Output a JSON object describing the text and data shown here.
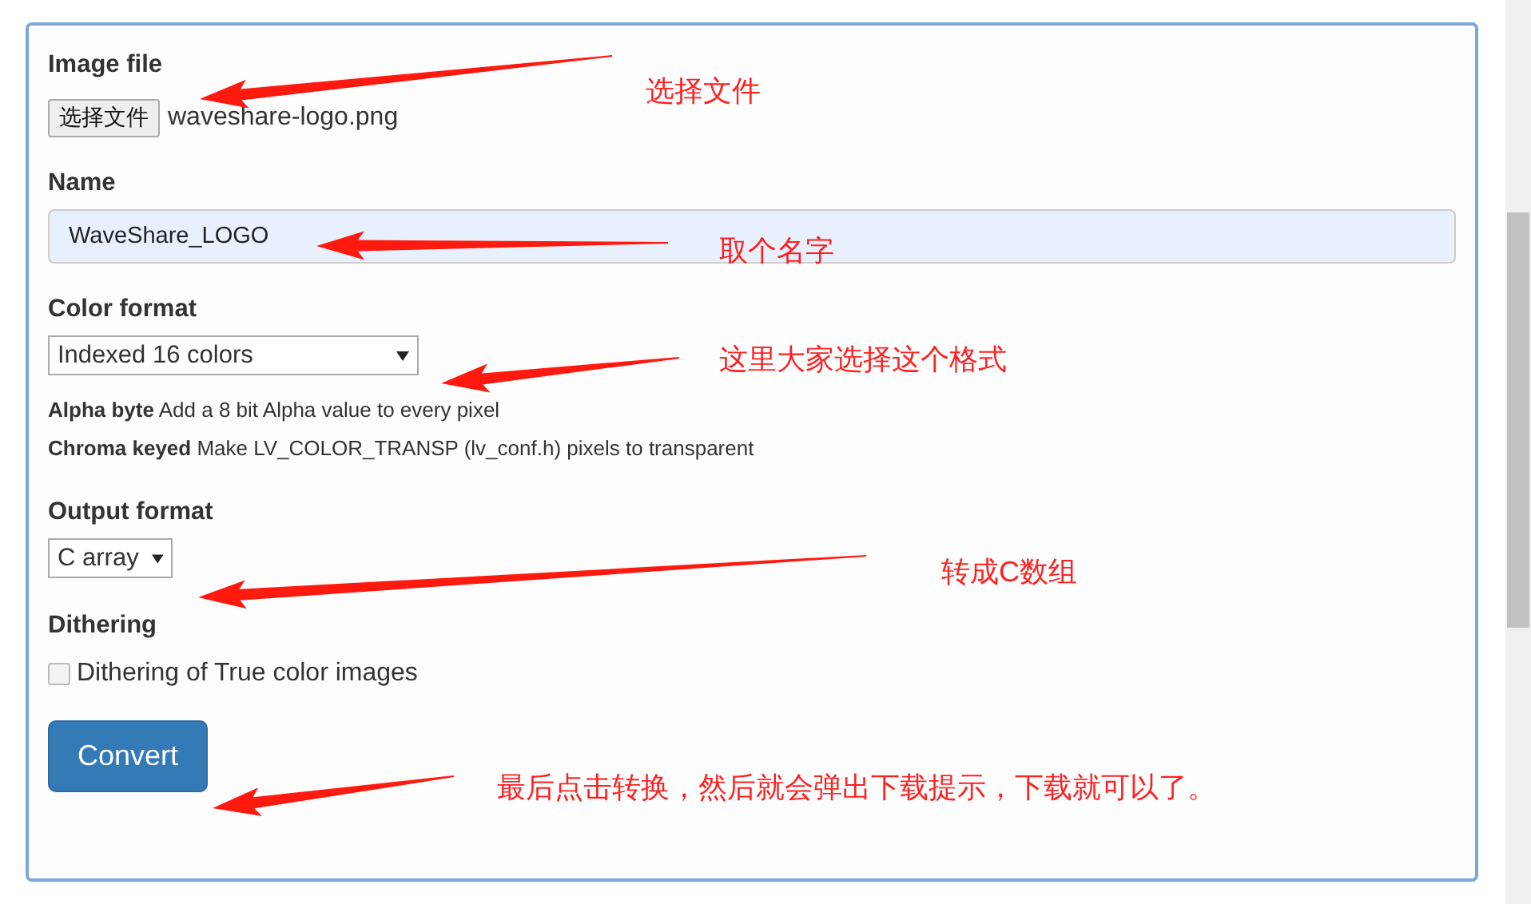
{
  "form": {
    "image_file": {
      "label": "Image file",
      "button": "选择文件",
      "file_name": "waveshare-logo.png"
    },
    "name": {
      "label": "Name",
      "value": "WaveShare_LOGO"
    },
    "color_format": {
      "label": "Color format",
      "value": "Indexed 16 colors",
      "notes": [
        "**Alpha byte** Add a 8 bit Alpha value to every pixel",
        "**Chroma keyed** Make LV_COLOR_TRANSP (lv_conf.h) pixels to transparent"
      ]
    },
    "output_format": {
      "label": "Output format",
      "value": "C array"
    },
    "dithering": {
      "label": "Dithering",
      "option": "Dithering of True color images",
      "checked": false
    },
    "submit": "Convert"
  },
  "annotations": [
    {
      "text": "选择文件"
    },
    {
      "text": "取个名字"
    },
    {
      "text": "这里大家选择这个格式"
    },
    {
      "text": "转成C数组"
    },
    {
      "text": "最后点击转换，然后就会弹出下载提示，下载就可以了。"
    }
  ]
}
